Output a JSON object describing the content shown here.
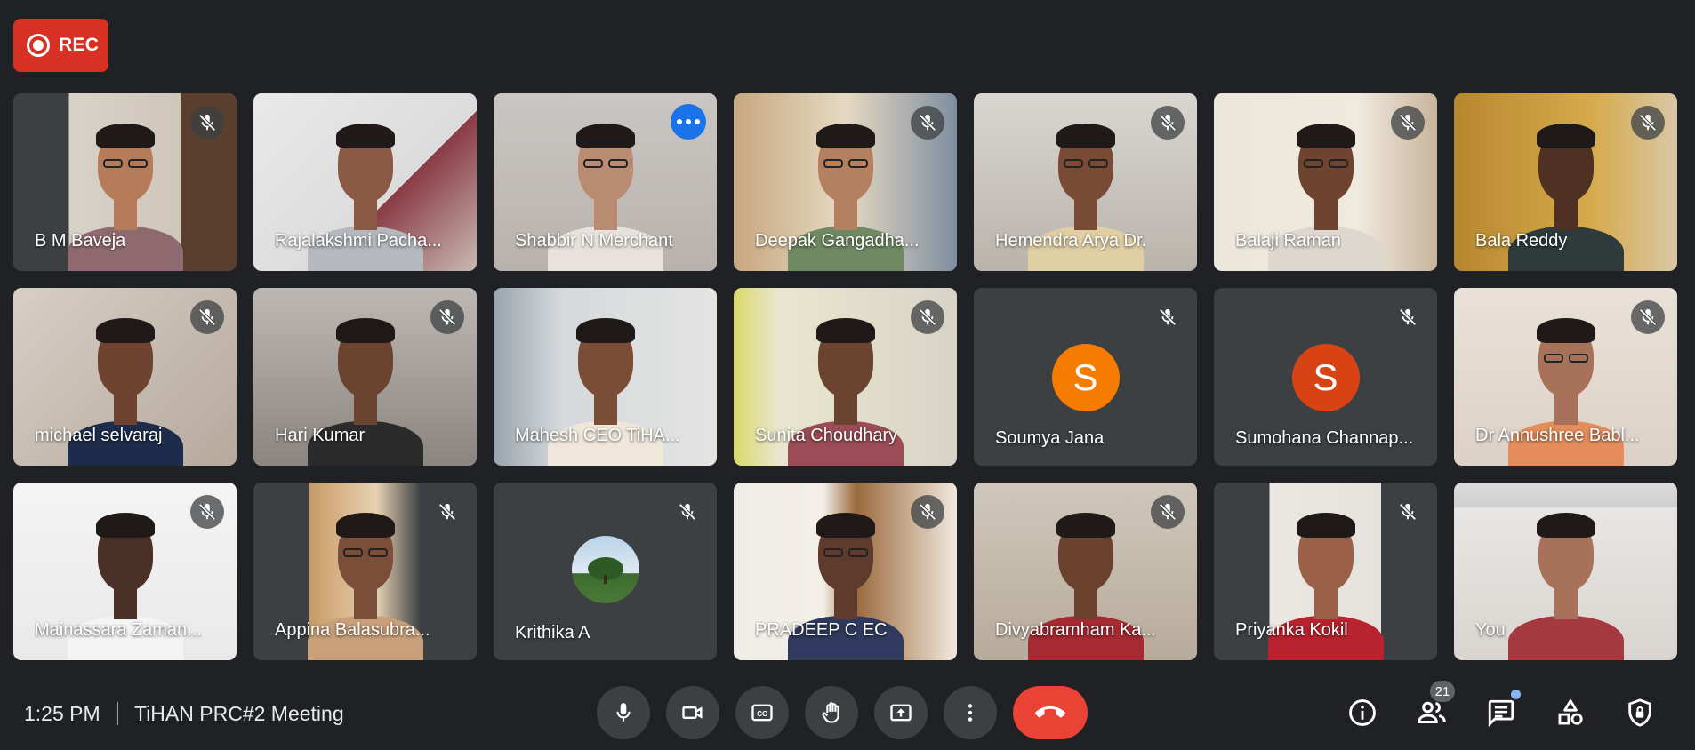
{
  "recording": {
    "label": "REC",
    "color": "#d93025"
  },
  "participants": [
    {
      "name": "B M Baveja",
      "muted": true,
      "bg": "linear-gradient(90deg,#3c4043 0%,#3c4043 25%,#d8d2c8 25%,#cfc6bb 75%,#5a3e2e 75%)",
      "skin": "#b67c5a",
      "shirt": "#8e6a70",
      "glasses": true
    },
    {
      "name": "Rajalakshmi Pacha...",
      "muted": false,
      "bg": "linear-gradient(135deg,#e9e9ea 0%,#dcdcdc 60%,#8a3b44 60%,#c8b9b3 100%)",
      "skin": "#8a5a45",
      "shirt": "#b5b9bd",
      "glasses": false
    },
    {
      "name": "Shabbir N Merchant",
      "muted": false,
      "speaking": true,
      "bg": "linear-gradient(#c9c6c3,#b9b2ac)",
      "skin": "#b98b73",
      "shirt": "#e7e2db",
      "glasses": true
    },
    {
      "name": "Deepak Gangadha...",
      "muted": true,
      "bg": "linear-gradient(90deg,#c7a77f 0%,#e5d9c2 50%,#7f8ea0 100%)",
      "skin": "#b58060",
      "shirt": "#6f8a63",
      "glasses": true
    },
    {
      "name": "Hemendra Arya Dr.",
      "muted": true,
      "bg": "linear-gradient(#d9d6d1,#b9b3ab)",
      "skin": "#7a4b34",
      "shirt": "#e0cfa3",
      "glasses": true
    },
    {
      "name": "Balaji Raman",
      "muted": true,
      "bg": "linear-gradient(90deg,#ece6db 0%,#efe9de 65%,#c9b49a 100%)",
      "skin": "#6e4430",
      "shirt": "#ddd7d0",
      "glasses": true
    },
    {
      "name": "Bala Reddy",
      "muted": true,
      "bg": "linear-gradient(90deg,#b7872e 0%,#d6a94a 60%,#d8c7a6 100%)",
      "skin": "#4f3124",
      "shirt": "#2f3a3a",
      "glasses": false
    },
    {
      "name": "michael selvaraj",
      "muted": true,
      "bg": "linear-gradient(135deg,#d7cec6,#b6a99c)",
      "skin": "#6e4331",
      "shirt": "#1d2c4a",
      "glasses": false
    },
    {
      "name": "Hari Kumar",
      "muted": true,
      "bg": "linear-gradient(#bdb8b3,#8b8580)",
      "skin": "#6b4331",
      "shirt": "#2c2b2b",
      "glasses": false
    },
    {
      "name": "Mahesh CEO TiHA...",
      "muted": false,
      "bg": "linear-gradient(90deg,#9aa4ab 0%,#d5d9dc 30%,#e4e4e2 100%)",
      "skin": "#7a4d37",
      "shirt": "#efe7d9",
      "glasses": false
    },
    {
      "name": "Sunita Choudhary",
      "muted": true,
      "bg": "linear-gradient(90deg,#d8d96a 0%,#e9e6cf 20%,#d9d3c6 100%)",
      "skin": "#6a4431",
      "shirt": "#9b4c57",
      "glasses": false
    },
    {
      "name": "Soumya Jana",
      "muted": true,
      "avatar": "S",
      "avatar_color": "#f57c00"
    },
    {
      "name": "Sumohana Channap...",
      "muted": true,
      "avatar": "S",
      "avatar_color": "#d84315"
    },
    {
      "name": "Dr Annushree Babl...",
      "muted": true,
      "bg": "linear-gradient(#e9e1d8,#dcd1c6)",
      "skin": "#a8725a",
      "shirt": "#e48d5b",
      "glasses": true
    },
    {
      "name": "Mainassara Zaman...",
      "muted": true,
      "bg": "linear-gradient(#f4f4f4,#e9e9e9)",
      "skin": "#4a3026",
      "shirt": "#f4f4f4",
      "glasses": false
    },
    {
      "name": "Appina Balasubra...",
      "muted": true,
      "bg": "linear-gradient(90deg,#3c4043 0%,#3c4043 25%,#c89a66 25%,#e6d2b2 55%,#3c4043 75%)",
      "skin": "#7a4e38",
      "shirt": "#c9a07a",
      "glasses": true
    },
    {
      "name": "Krithika A",
      "muted": true,
      "avatar": "",
      "avatar_photo": true
    },
    {
      "name": "PRADEEP C EC",
      "muted": true,
      "bg": "linear-gradient(90deg,#f0ede6 0%,#f3efe8 40%,#9b6a3d 55%,#f0e9de 100%)",
      "skin": "#5e3b2c",
      "shirt": "#2f3a5e",
      "glasses": true
    },
    {
      "name": "Divyabramham Ka...",
      "muted": true,
      "bg": "linear-gradient(#cfc7bb,#b7ab9b)",
      "skin": "#6a412f",
      "shirt": "#a62a32",
      "glasses": false
    },
    {
      "name": "Priyanka Kokil",
      "muted": true,
      "bg": "linear-gradient(90deg,#3c4043 0%,#3c4043 25%,#ebe7e2 25%,#e5e2dd 75%,#3c4043 75%)",
      "skin": "#9a6148",
      "shirt": "#b8232f",
      "glasses": false
    },
    {
      "name": "You",
      "muted": false,
      "bg": "linear-gradient(#dcdcdc 0%,#cfcfcf 14%,#e8e6e4 14%,#d9d4cf 100%)",
      "skin": "#a8715a",
      "shirt": "#a43a40",
      "glasses": false
    }
  ],
  "footer": {
    "time": "1:25 PM",
    "meeting_title": "TiHAN PRC#2 Meeting",
    "people_count": "21",
    "controls": [
      "mic-icon",
      "camera-icon",
      "captions-icon",
      "raise-hand-icon",
      "present-icon",
      "more-options-icon",
      "end-call-icon"
    ],
    "right_icons": [
      "info-icon",
      "people-icon",
      "chat-icon",
      "activities-icon",
      "host-controls-icon"
    ]
  }
}
